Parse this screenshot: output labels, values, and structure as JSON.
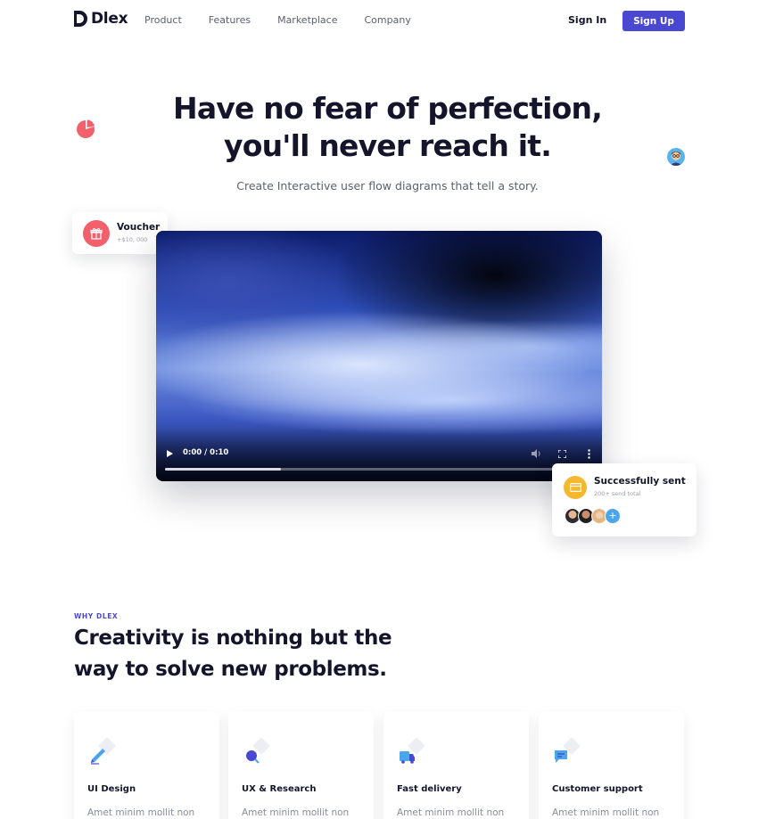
{
  "brand": {
    "name": "Dlex"
  },
  "nav": {
    "links": [
      "Product",
      "Features",
      "Marketplace",
      "Company"
    ],
    "signin_label": "Sign In",
    "signup_label": "Sign Up"
  },
  "hero": {
    "title_line1": "Have no fear of perfection,",
    "title_line2": "you'll never reach it.",
    "subtitle": "Create Interactive user flow diagrams that tell a story."
  },
  "voucher": {
    "title": "Voucher",
    "amount": "+$10, 000",
    "icon": "gift-icon"
  },
  "video": {
    "time": "0:00 / 0:10",
    "progress": 0.27
  },
  "sent_card": {
    "title": "Successfully sent",
    "subtitle": "200+ send total",
    "icon": "card-icon",
    "plus": "+"
  },
  "why": {
    "tag": "WHY DLEX",
    "title_line1": "Creativity is nothing but the",
    "title_line2": "way to solve new problems."
  },
  "features": [
    {
      "title": "UI Design",
      "text": "Amet minim mollit non",
      "icon": "pen-icon"
    },
    {
      "title": "UX & Research",
      "text": "Amet minim mollit non",
      "icon": "research-icon"
    },
    {
      "title": "Fast delivery",
      "text": "Amet minim mollit non",
      "icon": "truck-icon"
    },
    {
      "title": "Customer support",
      "text": "Amet minim mollit non",
      "icon": "chat-icon"
    }
  ],
  "colors": {
    "primary": "#4a48d1",
    "dark": "#14152b",
    "voucher": "#f2606b",
    "sent": "#f6b82f",
    "plus": "#4ba5ea"
  }
}
